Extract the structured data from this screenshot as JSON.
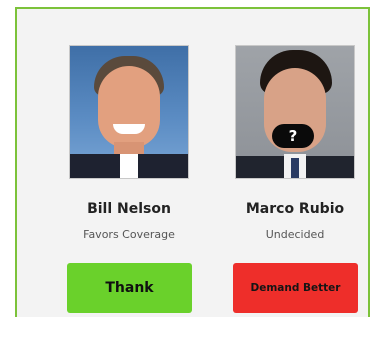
{
  "cards": [
    {
      "name": "Bill Nelson",
      "status": "Favors Coverage",
      "button_label": "Thank",
      "button_color": "#6ad12b"
    },
    {
      "name": "Marco Rubio",
      "status": "Undecided",
      "button_label": "Demand Better",
      "button_color": "#ee2e2a",
      "photo_overlay": "?"
    }
  ],
  "frame_border_color": "#7cc23a"
}
